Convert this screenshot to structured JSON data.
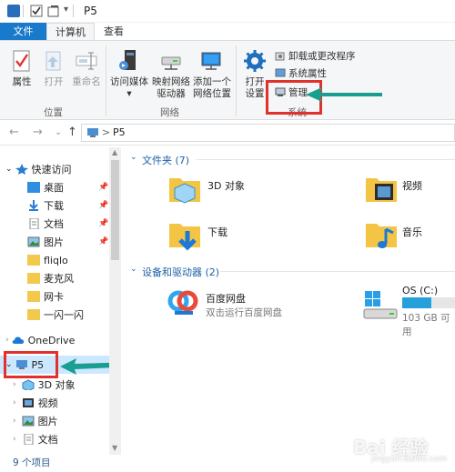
{
  "window": {
    "title": "P5"
  },
  "quick_access_toolbar": {
    "dropdown_glyph": "▾"
  },
  "tabs": [
    {
      "label": "文件"
    },
    {
      "label": "计算机"
    },
    {
      "label": "查看"
    }
  ],
  "ribbon": {
    "location_group": {
      "label": "位置",
      "buttons": [
        {
          "label": "属性"
        },
        {
          "label": "打开"
        },
        {
          "label": "重命名"
        }
      ]
    },
    "network_group": {
      "label": "网络",
      "buttons": [
        {
          "line1": "访问媒体",
          "line2": ""
        },
        {
          "line1": "映射网络",
          "line2": "驱动器"
        },
        {
          "line1": "添加一个",
          "line2": "网络位置"
        }
      ]
    },
    "system_group": {
      "label": "系统",
      "open_settings": {
        "line1": "打开",
        "line2": "设置"
      },
      "uninstall": "卸载或更改程序",
      "system_properties": "系统属性",
      "manage": "管理"
    }
  },
  "address": {
    "back": "←",
    "forward": "→",
    "history": "⌄",
    "up": "↑",
    "path": "P5",
    "sep": ">"
  },
  "nav": {
    "quick_access": "快速访问",
    "quick_items": [
      {
        "label": "桌面",
        "pinned": true
      },
      {
        "label": "下载",
        "pinned": true
      },
      {
        "label": "文档",
        "pinned": true
      },
      {
        "label": "图片",
        "pinned": true
      },
      {
        "label": "fliqlo",
        "pinned": false
      },
      {
        "label": "麦克风",
        "pinned": false
      },
      {
        "label": "网卡",
        "pinned": false
      },
      {
        "label": "一闪一闪",
        "pinned": false
      }
    ],
    "onedrive": "OneDrive",
    "this_pc": "P5",
    "pc_items": [
      {
        "label": "3D 对象"
      },
      {
        "label": "视频"
      },
      {
        "label": "图片"
      },
      {
        "label": "文档"
      }
    ]
  },
  "content": {
    "folders_header": "文件夹 (7)",
    "folders": [
      {
        "label": "3D 对象"
      },
      {
        "label": "视频"
      },
      {
        "label": "下载"
      },
      {
        "label": "音乐"
      }
    ],
    "devices_header": "设备和驱动器 (2)",
    "baidu": {
      "name": "百度网盘",
      "desc": "双击运行百度网盘"
    },
    "drive": {
      "name": "OS (C:)",
      "free": "103 GB 可用",
      "used_fraction": 0.55
    }
  },
  "status": {
    "items": "9 个项目"
  },
  "watermark": {
    "text": "Bai 经验",
    "sub": "jingyan.baidu.com"
  },
  "colors": {
    "accent": "#1979ca",
    "highlight": "#e0322d",
    "arrow": "#1a9e8f"
  }
}
